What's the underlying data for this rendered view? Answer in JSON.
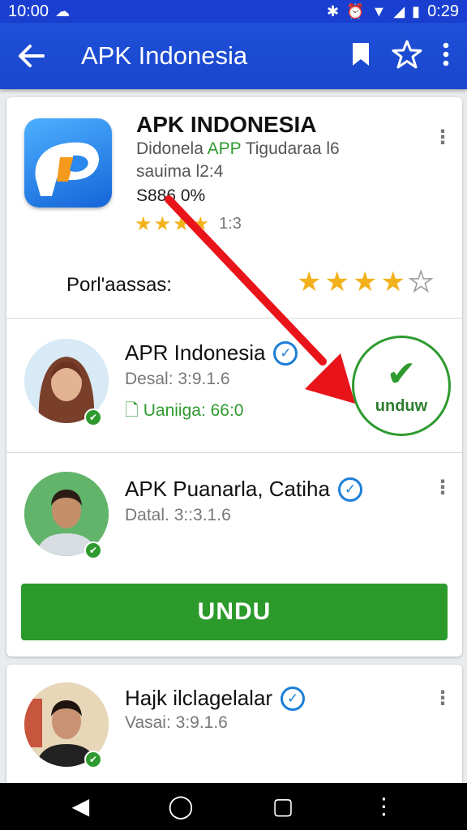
{
  "status_bar": {
    "time_left": "10:00",
    "time_right": "0:29"
  },
  "app_bar": {
    "title": "APK Indonesia"
  },
  "app_card": {
    "name": "APK INDONESIA",
    "subtitle_prefix": "Didonela",
    "subtitle_green": "APP",
    "subtitle_suffix": "Tigudaraa l6",
    "size": "sauima l2:4",
    "price": "S886 0%",
    "rating_count": "1:3",
    "small_stars": 3.5,
    "reviews_label": "Porl'aassas:",
    "big_stars": 4.5
  },
  "rows": [
    {
      "title": "APR Indonesia",
      "meta": "Desal: 3:9.1.6",
      "green": "Uaniiga: 66:0",
      "download_label": "unduw"
    },
    {
      "title": "APK Puanarla, Catiha",
      "meta": "Datal. 3::3.1.6"
    },
    {
      "title": "Hajk ilclagelalar",
      "meta": "Vasai: 3:9.1.6"
    }
  ],
  "download_button": "UNDU",
  "colors": {
    "primary": "#1d4ed8",
    "green": "#2e9a2e",
    "star": "#f3b11c",
    "arrow": "#e8141a"
  }
}
